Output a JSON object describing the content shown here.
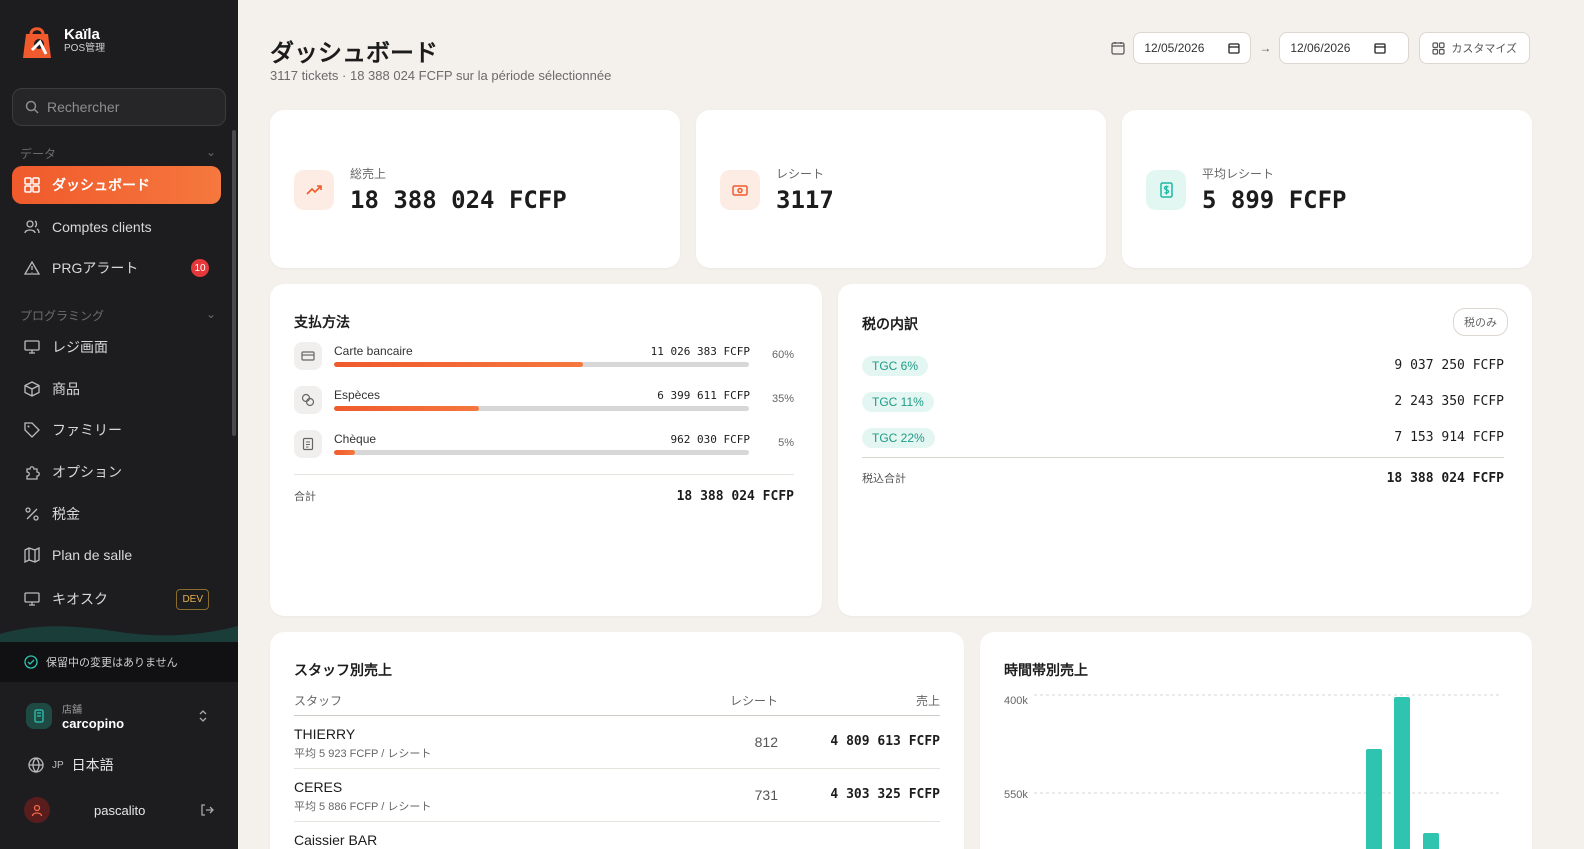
{
  "brand": {
    "name": "Kaïla",
    "subtitle": "POS管理"
  },
  "search": {
    "placeholder": "Rechercher"
  },
  "sidebar": {
    "section_data": "データ",
    "section_programming": "プログラミング",
    "items": [
      {
        "label": "ダッシュボード",
        "icon": "dashboard-grid-icon",
        "active": true
      },
      {
        "label": "Comptes clients",
        "icon": "users-icon"
      },
      {
        "label": "PRGアラート",
        "icon": "warning-triangle-icon",
        "badge": "10"
      },
      {
        "label": "レジ画面",
        "icon": "monitor-icon"
      },
      {
        "label": "商品",
        "icon": "box-icon"
      },
      {
        "label": "ファミリー",
        "icon": "tag-icon"
      },
      {
        "label": "オプション",
        "icon": "puzzle-icon"
      },
      {
        "label": "税金",
        "icon": "percent-icon"
      },
      {
        "label": "Plan de salle",
        "icon": "map-icon"
      },
      {
        "label": "キオスク",
        "icon": "monitor-icon",
        "tag": "DEV"
      }
    ],
    "pending": "保留中の変更はありません",
    "store_label": "店舗",
    "store_name": "carcopino",
    "lang_code": "JP",
    "lang_name": "日本語",
    "user_name": "pascalito"
  },
  "header": {
    "title": "ダッシュボード",
    "subtitle": "3117 tickets · 18 388 024 FCFP sur la période sélectionnée",
    "date_from": "12/05/2026",
    "date_to": "12/06/2026",
    "arrow": "→",
    "customize": "カスタマイズ"
  },
  "kpis": [
    {
      "label": "総売上",
      "value": "18 388 024  FCFP",
      "icon": "trending-up-icon",
      "color": "#f05a2c"
    },
    {
      "label": "レシート",
      "value": "3117",
      "icon": "banknote-icon",
      "color": "#f05a2c"
    },
    {
      "label": "平均レシート",
      "value": "5 899  FCFP",
      "icon": "dollar-receipt-icon",
      "color": "#1fb8a4"
    }
  ],
  "payments": {
    "title": "支払方法",
    "rows": [
      {
        "name": "Carte bancaire",
        "amount": "11 026 383  FCFP",
        "pct": "60%",
        "share": 0.6,
        "icon": "credit-card-icon"
      },
      {
        "name": "Espèces",
        "amount": "6 399 611  FCFP",
        "pct": "35%",
        "share": 0.35,
        "icon": "coins-icon"
      },
      {
        "name": "Chèque",
        "amount": "962 030  FCFP",
        "pct": "5%",
        "share": 0.05,
        "icon": "cheque-icon"
      }
    ],
    "total_label": "合計",
    "total_value": "18 388 024  FCFP"
  },
  "taxes": {
    "title": "税の内訳",
    "filter": "税のみ",
    "rows": [
      {
        "name": "TGC 6%",
        "amount": "9 037 250  FCFP"
      },
      {
        "name": "TGC 11%",
        "amount": "2 243 350  FCFP"
      },
      {
        "name": "TGC 22%",
        "amount": "7 153 914  FCFP"
      }
    ],
    "total_label": "税込合計",
    "total_value": "18 388 024  FCFP"
  },
  "staff": {
    "title": "スタッフ別売上",
    "col_staff": "スタッフ",
    "col_receipts": "レシート",
    "col_sales": "売上",
    "rows": [
      {
        "name": "THIERRY",
        "avg": "平均  5 923  FCFP  /  レシート",
        "count": "812",
        "total": "4 809 613  FCFP"
      },
      {
        "name": "CERES",
        "avg": "平均  5 886  FCFP  /  レシート",
        "count": "731",
        "total": "4 303 325  FCFP"
      },
      {
        "name": "Caissier BAR",
        "avg": "",
        "count": "",
        "total": ""
      }
    ]
  },
  "chart_data": {
    "type": "bar",
    "title": "時間帯別売上",
    "y_tick_labels": [
      "400k",
      "550k"
    ],
    "grid": true,
    "color": "#2ec4b0",
    "bars_visible_partial": true
  }
}
